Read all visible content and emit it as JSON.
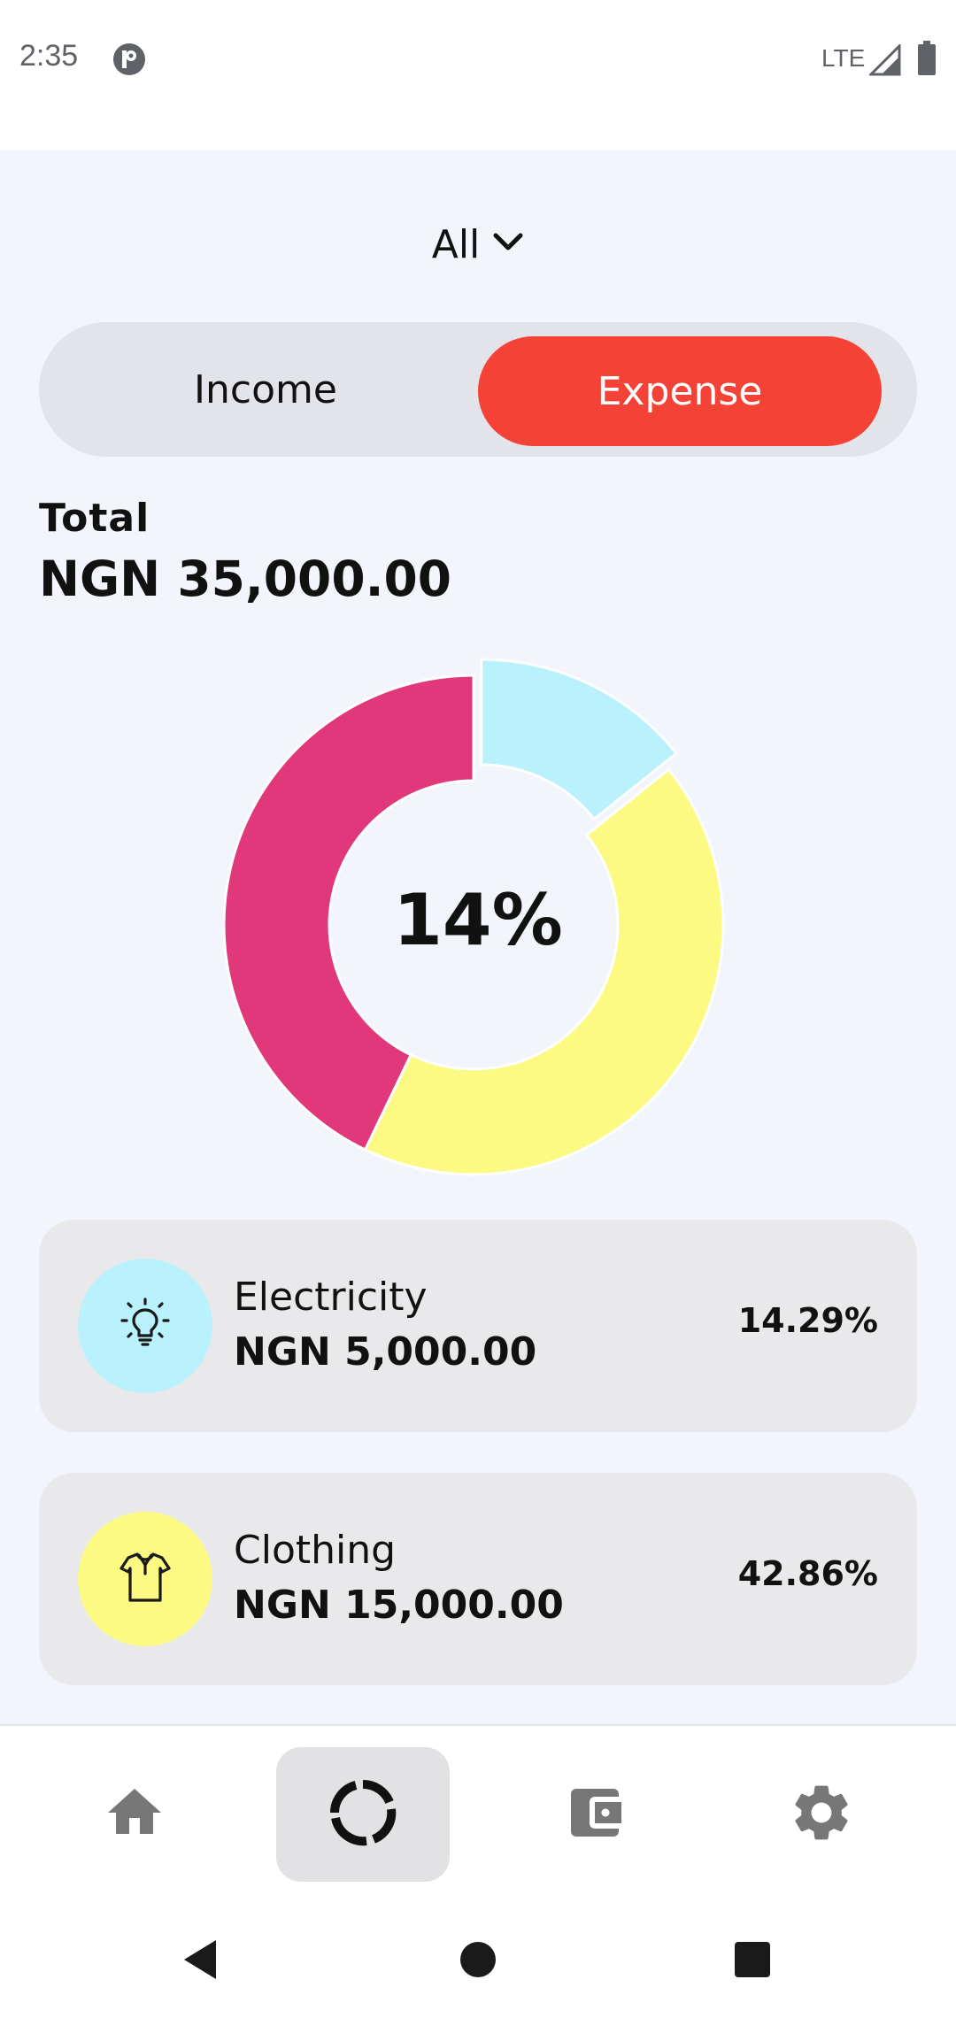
{
  "status_bar": {
    "time": "2:35",
    "network": "LTE"
  },
  "period_filter": {
    "selected": "All"
  },
  "type_toggle": {
    "income_label": "Income",
    "expense_label": "Expense",
    "selected": "Expense"
  },
  "total": {
    "label": "Total",
    "value": "NGN 35,000.00"
  },
  "chart_data": {
    "type": "pie",
    "center_label": "14%",
    "slices": [
      {
        "name": "Electricity",
        "value": 14.29,
        "color": "#b9f2fd",
        "highlighted": true
      },
      {
        "name": "Clothing",
        "value": 42.86,
        "color": "#fdfa83"
      },
      {
        "name": "",
        "value": 42.85,
        "color": "#e0387a"
      }
    ]
  },
  "categories": [
    {
      "name": "Electricity",
      "amount": "NGN 5,000.00",
      "percent": "14.29%",
      "icon": "lightbulb-icon",
      "color": "#b9f2fd"
    },
    {
      "name": "Clothing",
      "amount": "NGN 15,000.00",
      "percent": "42.86%",
      "icon": "shirt-icon",
      "color": "#fdfa83"
    }
  ],
  "bottom_nav": {
    "items": [
      {
        "icon": "home-icon",
        "active": false
      },
      {
        "icon": "stats-icon",
        "active": true
      },
      {
        "icon": "wallet-icon",
        "active": false
      },
      {
        "icon": "settings-icon",
        "active": false
      }
    ]
  },
  "colors": {
    "accent": "#f44336",
    "background": "#f2f5fb",
    "card": "#e9e9eb"
  }
}
